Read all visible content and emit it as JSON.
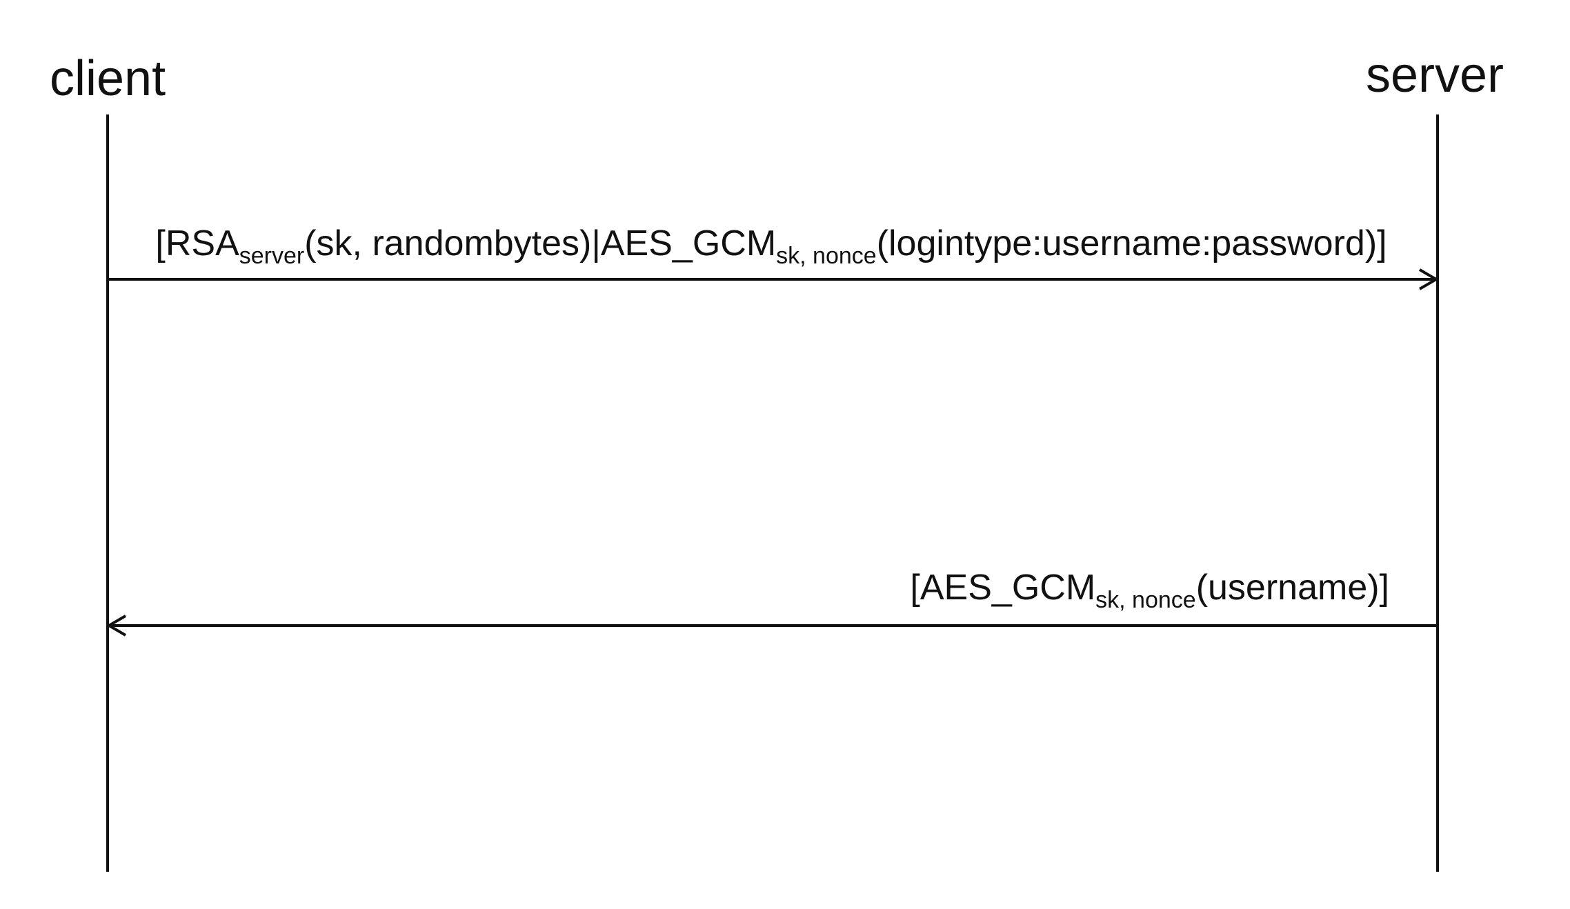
{
  "participants": {
    "left": "client",
    "right": "server"
  },
  "messages": [
    {
      "direction": "right",
      "parts": [
        {
          "text": "[RSA",
          "sub": false
        },
        {
          "text": "server",
          "sub": true
        },
        {
          "text": "(sk, randombytes)|AES_GCM",
          "sub": false
        },
        {
          "text": "sk, nonce",
          "sub": true
        },
        {
          "text": "(logintype:username:password)]",
          "sub": false
        }
      ]
    },
    {
      "direction": "left",
      "parts": [
        {
          "text": "[AES_GCM",
          "sub": false
        },
        {
          "text": "sk, nonce",
          "sub": true
        },
        {
          "text": "(username)]",
          "sub": false
        }
      ]
    }
  ]
}
